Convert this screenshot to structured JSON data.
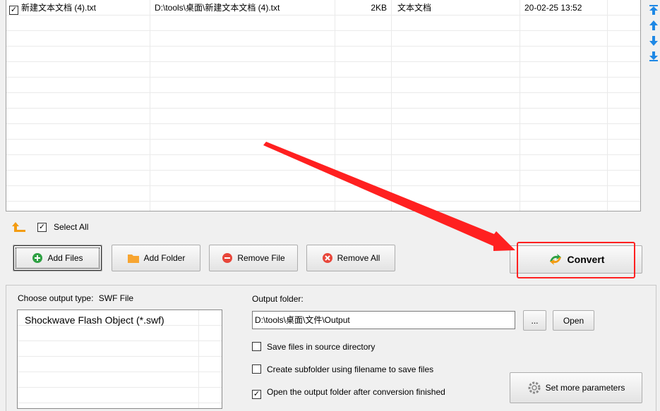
{
  "file_list": {
    "rows": [
      {
        "checked": true,
        "name": "新建文本文档 (4).txt",
        "path": "D:\\tools\\桌面\\新建文本文档 (4).txt",
        "size": "2KB",
        "type": "文本文档",
        "date": "20-02-25 13:52"
      }
    ]
  },
  "select_all": {
    "label": "Select All",
    "checked": true
  },
  "buttons": {
    "add_files": "Add Files",
    "add_folder": "Add Folder",
    "remove_file": "Remove File",
    "remove_all": "Remove All",
    "convert": "Convert",
    "browse": "...",
    "open": "Open",
    "set_params": "Set more parameters"
  },
  "output": {
    "choose_label": "Choose output type:",
    "choose_value": "SWF File",
    "types": [
      "Shockwave Flash Object (*.swf)"
    ],
    "folder_label": "Output folder:",
    "folder_value": "D:\\tools\\桌面\\文件\\Output",
    "options": [
      {
        "label": "Save files in source directory",
        "checked": false
      },
      {
        "label": "Create subfolder using filename to save files",
        "checked": false
      },
      {
        "label": "Open the output folder after conversion finished",
        "checked": true
      }
    ]
  },
  "colors": {
    "annotation_red": "#ff2020",
    "add_green": "#2ea043",
    "folder_orange": "#f7a531",
    "remove_red": "#e8463a",
    "arrow_blue": "#1e88e5"
  }
}
